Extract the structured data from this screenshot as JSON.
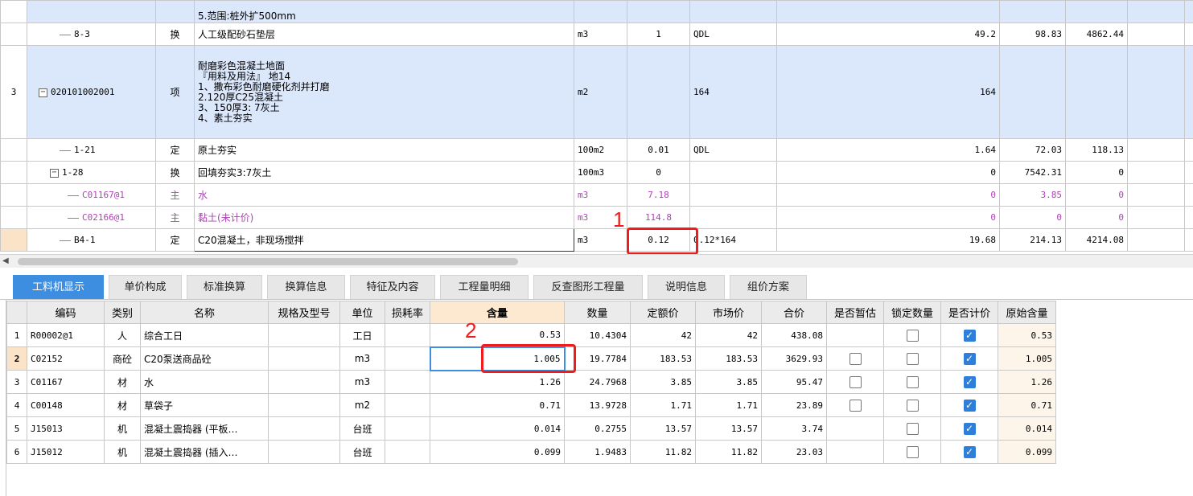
{
  "upper": {
    "top_partial": "5.范围:桩外扩500mm",
    "rows": [
      {
        "num": "",
        "code": "8-3",
        "type": "换",
        "name": "人工级配砂石垫层",
        "unit": "m3",
        "qty_expr": "1",
        "qty": "QDL",
        "c1": "49.2",
        "c2": "98.83",
        "c3": "4862.44"
      },
      {
        "num": "3",
        "code": "020101002001",
        "type": "项",
        "name_lines": [
          "耐磨彩色混凝土地面",
          "『用料及用法』 地14",
          "1、撒布彩色耐磨硬化剂并打磨",
          "2.120厚C25混凝土",
          "3、150厚3: 7灰土",
          "4、素土夯实"
        ],
        "unit": "m2",
        "qty_expr": "",
        "qty": "164",
        "c1": "164",
        "c2": "",
        "c3": ""
      },
      {
        "num": "",
        "code": "1-21",
        "type": "定",
        "name": "原土夯实",
        "unit": "100m2",
        "qty_expr": "0.01",
        "qty": "QDL",
        "c1": "1.64",
        "c2": "72.03",
        "c3": "118.13"
      },
      {
        "num": "",
        "code": "1-28",
        "type": "换",
        "name": "回填夯实3:7灰土",
        "unit": "100m3",
        "qty_expr": "0",
        "qty": "",
        "c1": "0",
        "c2": "7542.31",
        "c3": "0"
      },
      {
        "num": "",
        "code": "C01167@1",
        "type": "主",
        "name": "水",
        "unit": "m3",
        "qty_expr": "7.18",
        "qty": "",
        "c1": "0",
        "c2": "3.85",
        "c3": "0"
      },
      {
        "num": "",
        "code": "C02166@1",
        "type": "主",
        "name": "黏土(未计价)",
        "unit": "m3",
        "qty_expr": "114.8",
        "qty": "",
        "c1": "0",
        "c2": "0",
        "c3": "0"
      },
      {
        "num": "",
        "code": "B4-1",
        "type": "定",
        "name": "C20混凝土，非现场搅拌",
        "unit": "m3",
        "qty_expr": "0.12",
        "qty": "0.12*164",
        "c1": "19.68",
        "c2": "214.13",
        "c3": "4214.08"
      }
    ]
  },
  "tabs": [
    "工料机显示",
    "单价构成",
    "标准换算",
    "换算信息",
    "特征及内容",
    "工程量明细",
    "反查图形工程量",
    "说明信息",
    "组价方案"
  ],
  "lower": {
    "headers": [
      "",
      "编码",
      "类别",
      "名称",
      "规格及型号",
      "单位",
      "损耗率",
      "含量",
      "数量",
      "定额价",
      "市场价",
      "合价",
      "是否暂估",
      "锁定数量",
      "是否计价",
      "原始含量"
    ],
    "rows": [
      {
        "n": "1",
        "code": "R00002@1",
        "cat": "人",
        "name": "综合工日",
        "spec": "",
        "unit": "工日",
        "loss": "",
        "amt": "0.53",
        "qty": "10.4304",
        "p1": "42",
        "p2": "42",
        "total": "438.08",
        "est": "",
        "lock": "box",
        "priced": "on",
        "orig": "0.53"
      },
      {
        "n": "2",
        "code": "C02152",
        "cat": "商砼",
        "name": "C20泵送商品砼",
        "spec": "",
        "unit": "m3",
        "loss": "",
        "amt": "1.005",
        "qty": "19.7784",
        "p1": "183.53",
        "p2": "183.53",
        "total": "3629.93",
        "est": "box",
        "lock": "box",
        "priced": "on",
        "orig": "1.005"
      },
      {
        "n": "3",
        "code": "C01167",
        "cat": "材",
        "name": "水",
        "spec": "",
        "unit": "m3",
        "loss": "",
        "amt": "1.26",
        "qty": "24.7968",
        "p1": "3.85",
        "p2": "3.85",
        "total": "95.47",
        "est": "box",
        "lock": "box",
        "priced": "on",
        "orig": "1.26"
      },
      {
        "n": "4",
        "code": "C00148",
        "cat": "材",
        "name": "草袋子",
        "spec": "",
        "unit": "m2",
        "loss": "",
        "amt": "0.71",
        "qty": "13.9728",
        "p1": "1.71",
        "p2": "1.71",
        "total": "23.89",
        "est": "box",
        "lock": "box",
        "priced": "on",
        "orig": "0.71"
      },
      {
        "n": "5",
        "code": "J15013",
        "cat": "机",
        "name": "混凝土震捣器 (平板…",
        "spec": "",
        "unit": "台班",
        "loss": "",
        "amt": "0.014",
        "qty": "0.2755",
        "p1": "13.57",
        "p2": "13.57",
        "total": "3.74",
        "est": "",
        "lock": "box",
        "priced": "on",
        "orig": "0.014"
      },
      {
        "n": "6",
        "code": "J15012",
        "cat": "机",
        "name": "混凝土震捣器 (插入…",
        "spec": "",
        "unit": "台班",
        "loss": "",
        "amt": "0.099",
        "qty": "1.9483",
        "p1": "11.82",
        "p2": "11.82",
        "total": "23.03",
        "est": "",
        "lock": "box",
        "priced": "on",
        "orig": "0.099"
      }
    ]
  },
  "annotations": {
    "one": "1",
    "two": "2",
    "color": "#ee1c1c"
  },
  "colors": {
    "accent": "#3d8de0",
    "row_blue": "#dbe7fb",
    "main_material": "#b040b8"
  },
  "icons": {
    "expand": "minus-box-icon",
    "check": "checkmark-icon",
    "scroll_left": "left-arrow-icon"
  }
}
